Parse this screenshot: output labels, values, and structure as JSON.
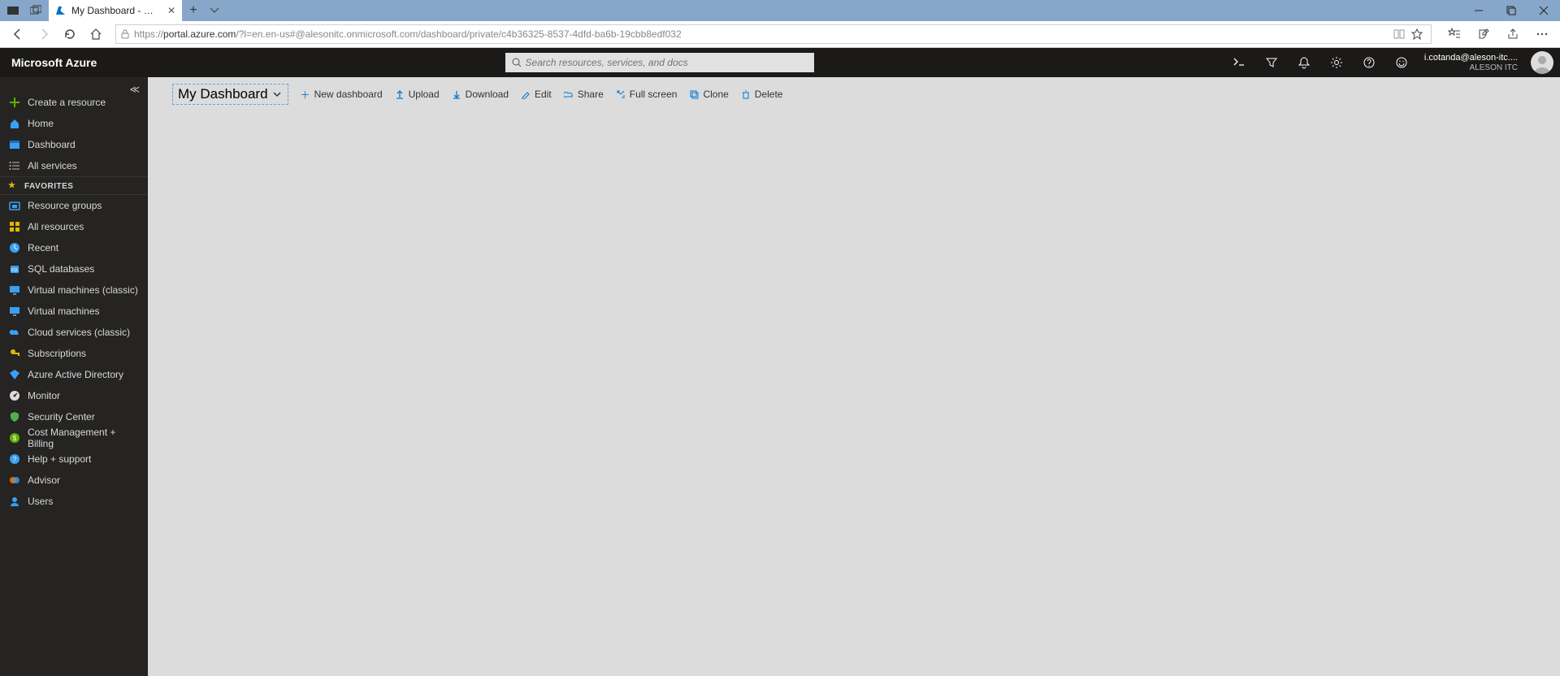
{
  "browser": {
    "tab_title": "My Dashboard - Micros",
    "url_prefix": "https://",
    "url_host": "portal.azure.com",
    "url_path": "/?l=en.en-us#@alesonitc.onmicrosoft.com/dashboard/private/c4b36325-8537-4dfd-ba6b-19cbb8edf032"
  },
  "azure": {
    "brand": "Microsoft Azure",
    "search_placeholder": "Search resources, services, and docs",
    "account_email": "i.cotanda@aleson-itc....",
    "account_company": "ALESON ITC"
  },
  "sidebar": {
    "create": "Create a resource",
    "home": "Home",
    "dashboard": "Dashboard",
    "all_services": "All services",
    "favorites_label": "FAVORITES",
    "items": [
      "Resource groups",
      "All resources",
      "Recent",
      "SQL databases",
      "Virtual machines (classic)",
      "Virtual machines",
      "Cloud services (classic)",
      "Subscriptions",
      "Azure Active Directory",
      "Monitor",
      "Security Center",
      "Cost Management + Billing",
      "Help + support",
      "Advisor",
      "Users"
    ]
  },
  "dashboard": {
    "title": "My Dashboard",
    "actions": {
      "new": "New dashboard",
      "upload": "Upload",
      "download": "Download",
      "edit": "Edit",
      "share": "Share",
      "fullscreen": "Full screen",
      "clone": "Clone",
      "delete": "Delete"
    }
  }
}
